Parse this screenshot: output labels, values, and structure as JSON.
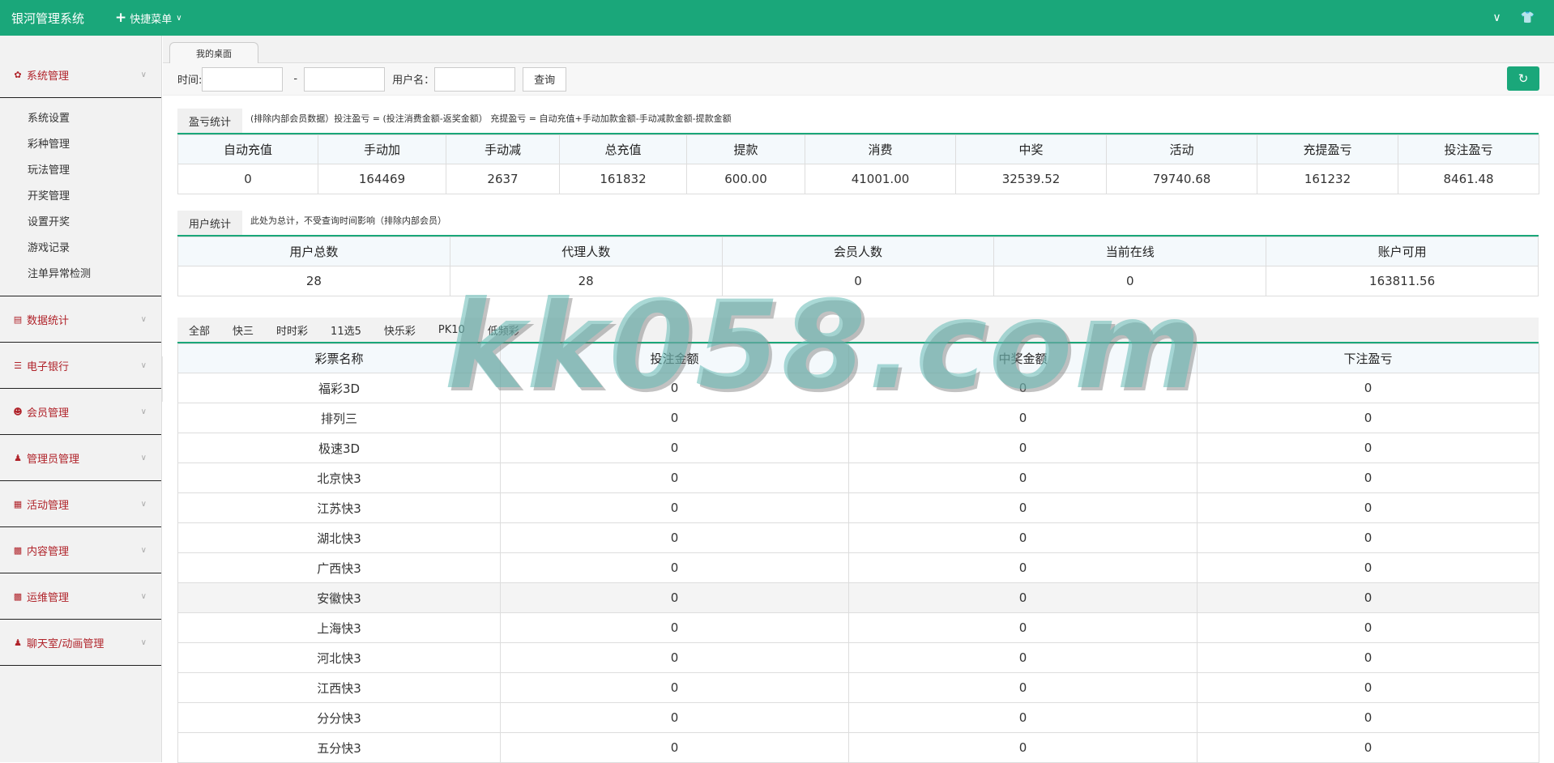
{
  "header": {
    "brand": "银河管理系统",
    "quick_menu": "快捷菜单"
  },
  "sidebar": {
    "groups": [
      {
        "label": "系统管理",
        "icon": "gear-icon",
        "items": [
          "系统设置",
          "彩种管理",
          "玩法管理",
          "开奖管理",
          "设置开奖",
          "游戏记录",
          "注单异常检测"
        ]
      },
      {
        "label": "数据统计",
        "icon": "chart-icon"
      },
      {
        "label": "电子银行",
        "icon": "list-icon"
      },
      {
        "label": "会员管理",
        "icon": "user-icon"
      },
      {
        "label": "管理员管理",
        "icon": "admin-icon"
      },
      {
        "label": "活动管理",
        "icon": "gift-icon"
      },
      {
        "label": "内容管理",
        "icon": "book-icon"
      },
      {
        "label": "运维管理",
        "icon": "book-icon"
      },
      {
        "label": "聊天室/动画管理",
        "icon": "user-icon"
      }
    ]
  },
  "tabs": {
    "desktop": "我的桌面"
  },
  "filter": {
    "time_label": "时间:",
    "dash": "-",
    "username_label": "用户名：",
    "query_button": "查询"
  },
  "profit": {
    "tab": "盈亏统计",
    "note": "(排除内部会员数据）投注盈亏 = (投注消费金额-返奖金额）   充提盈亏 = 自动充值+手动加款金额-手动减款金额-提款金额",
    "headers": [
      "自动充值",
      "手动加",
      "手动减",
      "总充值",
      "提款",
      "消费",
      "中奖",
      "活动",
      "充提盈亏",
      "投注盈亏"
    ],
    "values": [
      "0",
      "164469",
      "2637",
      "161832",
      "600.00",
      "41001.00",
      "32539.52",
      "79740.68",
      "161232",
      "8461.48"
    ]
  },
  "users": {
    "tab": "用户统计",
    "note": "此处为总计，不受查询时间影响（排除内部会员）",
    "headers": [
      "用户总数",
      "代理人数",
      "会员人数",
      "当前在线",
      "账户可用"
    ],
    "values": [
      "28",
      "28",
      "0",
      "0",
      "163811.56"
    ]
  },
  "lottery": {
    "filters": [
      "全部",
      "快三",
      "时时彩",
      "11选5",
      "快乐彩",
      "PK10",
      "低频彩"
    ],
    "headers": [
      "彩票名称",
      "投注金额",
      "中奖金额",
      "下注盈亏"
    ],
    "rows": [
      [
        "福彩3D",
        "0",
        "0",
        "0"
      ],
      [
        "排列三",
        "0",
        "0",
        "0"
      ],
      [
        "极速3D",
        "0",
        "0",
        "0"
      ],
      [
        "北京快3",
        "0",
        "0",
        "0"
      ],
      [
        "江苏快3",
        "0",
        "0",
        "0"
      ],
      [
        "湖北快3",
        "0",
        "0",
        "0"
      ],
      [
        "广西快3",
        "0",
        "0",
        "0"
      ],
      [
        "安徽快3",
        "0",
        "0",
        "0"
      ],
      [
        "上海快3",
        "0",
        "0",
        "0"
      ],
      [
        "河北快3",
        "0",
        "0",
        "0"
      ],
      [
        "江西快3",
        "0",
        "0",
        "0"
      ],
      [
        "分分快3",
        "0",
        "0",
        "0"
      ],
      [
        "五分快3",
        "0",
        "0",
        "0"
      ]
    ]
  },
  "watermark": "kk058.com"
}
